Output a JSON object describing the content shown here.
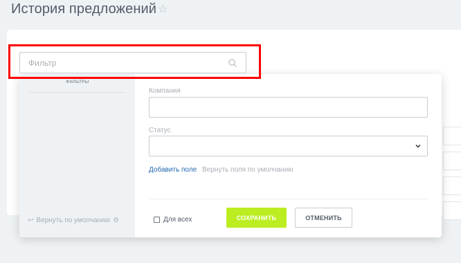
{
  "page": {
    "title": "История предложений",
    "star_icon": "star-outline-icon"
  },
  "search": {
    "placeholder": "Фильтр",
    "value": "",
    "icon": "search-icon"
  },
  "popup": {
    "sidebar": {
      "heading": "ФИЛЬТРЫ",
      "reset_label": "Вернуть по умолчанию",
      "reset_icon": "undo-arrow-icon",
      "settings_icon": "gear-icon"
    },
    "fields": [
      {
        "label": "Компания",
        "type": "text",
        "value": ""
      },
      {
        "label": "Статус",
        "type": "select",
        "value": ""
      }
    ],
    "add_field_label": "Добавить поле",
    "restore_fields_label": "Вернуть поля по умолчанию",
    "for_all_label": "Для всех",
    "for_all_checked": false,
    "save_label": "СОХРАНИТЬ",
    "cancel_label": "ОТМЕНИТЬ"
  },
  "colors": {
    "accent_green": "#bbed21",
    "link_blue": "#2067b0",
    "highlight_red": "#ff0000",
    "background": "#eef2f4"
  }
}
